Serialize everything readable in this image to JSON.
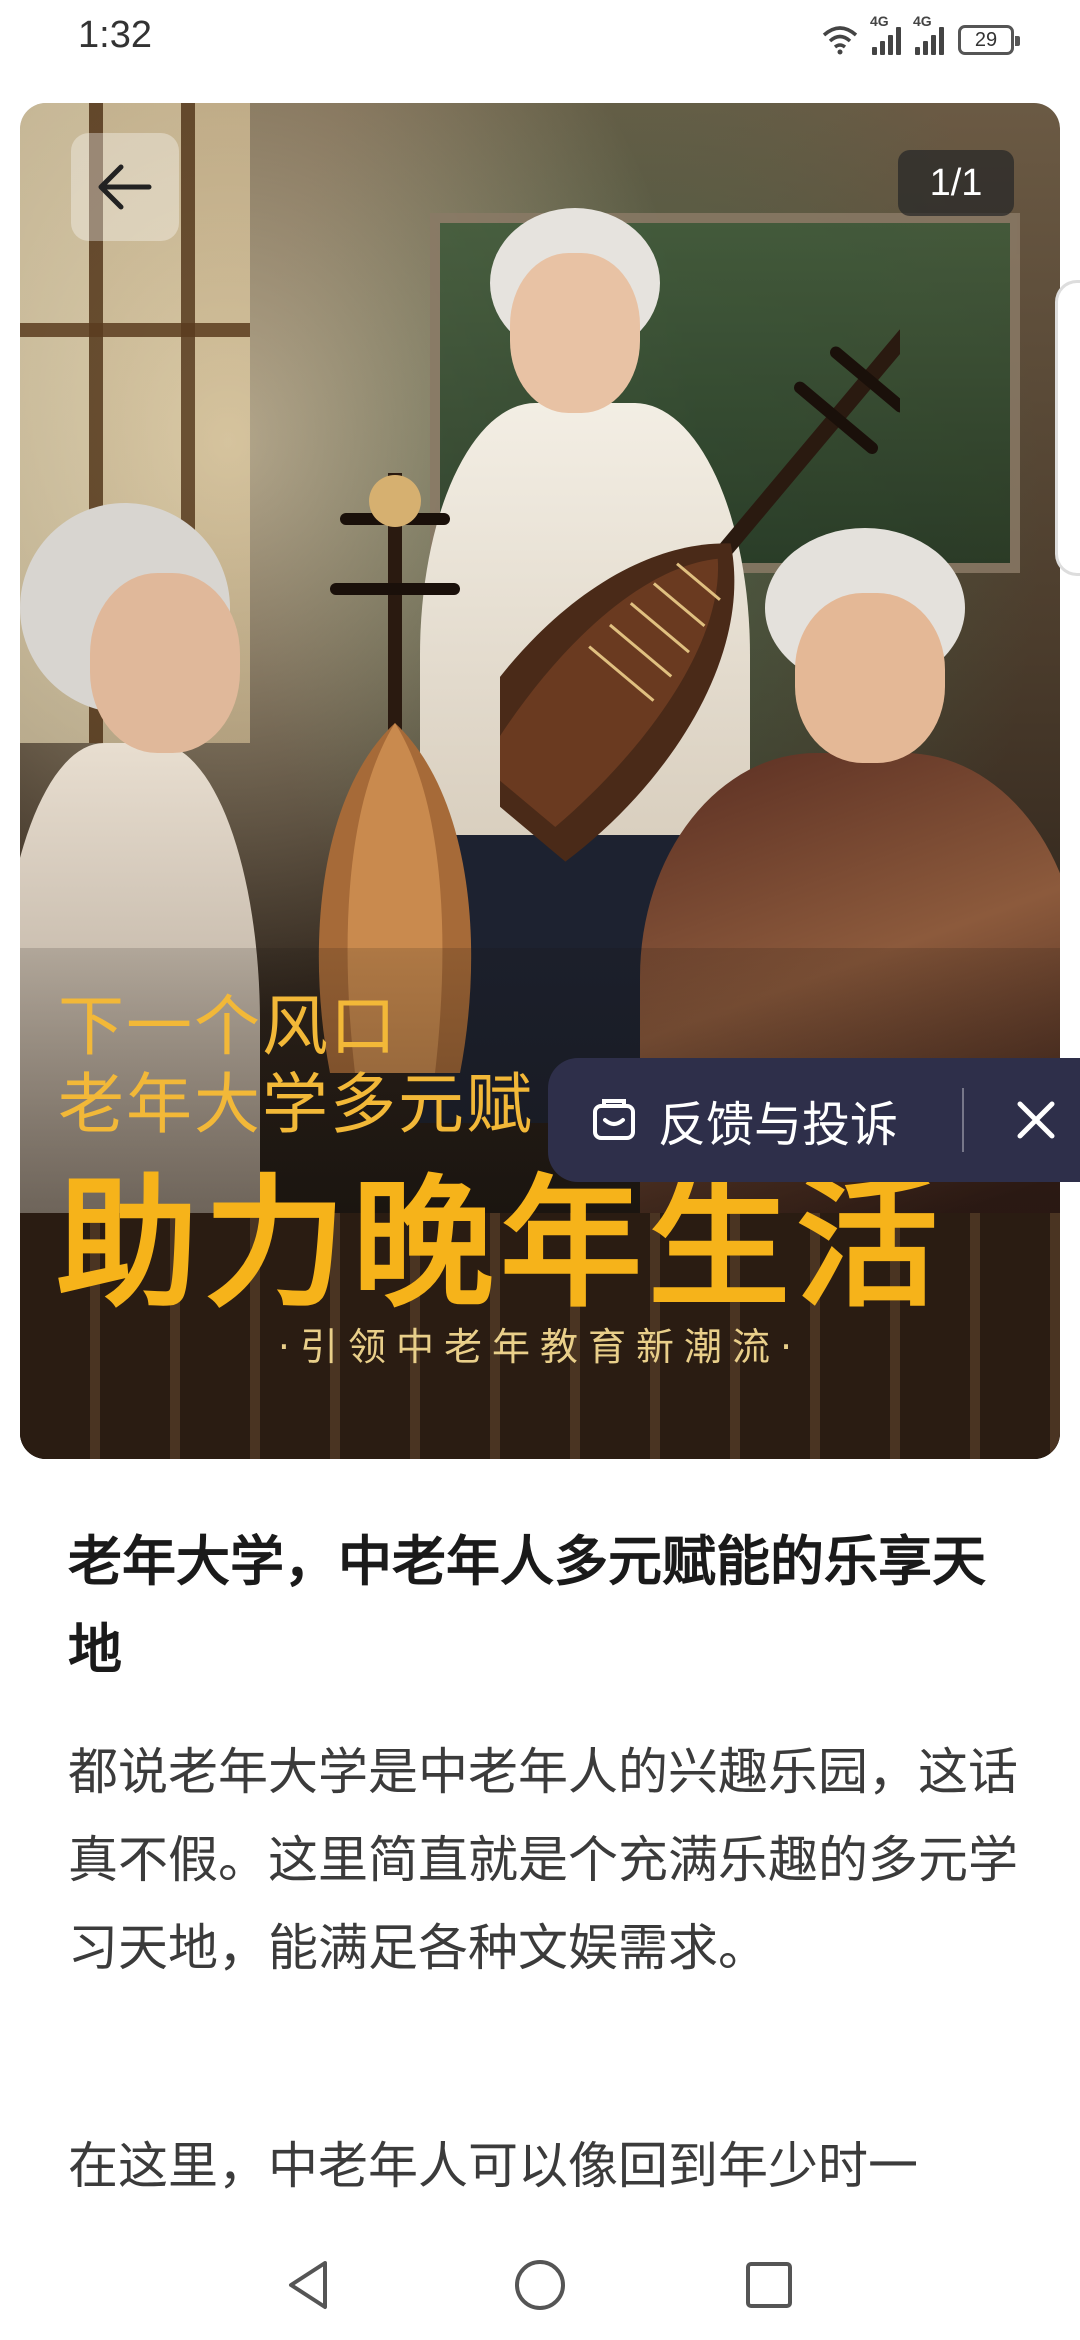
{
  "status_bar": {
    "time": "1:32",
    "network_1": "4G",
    "network_2": "4G",
    "battery": "29"
  },
  "hero": {
    "page_counter": "1/1",
    "line1": "下一个风口",
    "line2": "老年大学多元赋",
    "headline": "助力晚年生活",
    "tagline": "·引领中老年教育新潮流·"
  },
  "feedback": {
    "label": "反馈与投诉"
  },
  "article": {
    "title": "老年大学，中老年人多元赋能的乐享天地",
    "paragraph1": "都说老年大学是中老年人的兴趣乐园，这话真不假。这里简直就是个充满乐趣的多元学习天地，能满足各种文娱需求。",
    "paragraph2": "在这里，中老年人可以像回到年少时一"
  },
  "colors": {
    "accent_gold": "#f6b31a",
    "feedback_bg": "#2e2f4a"
  }
}
